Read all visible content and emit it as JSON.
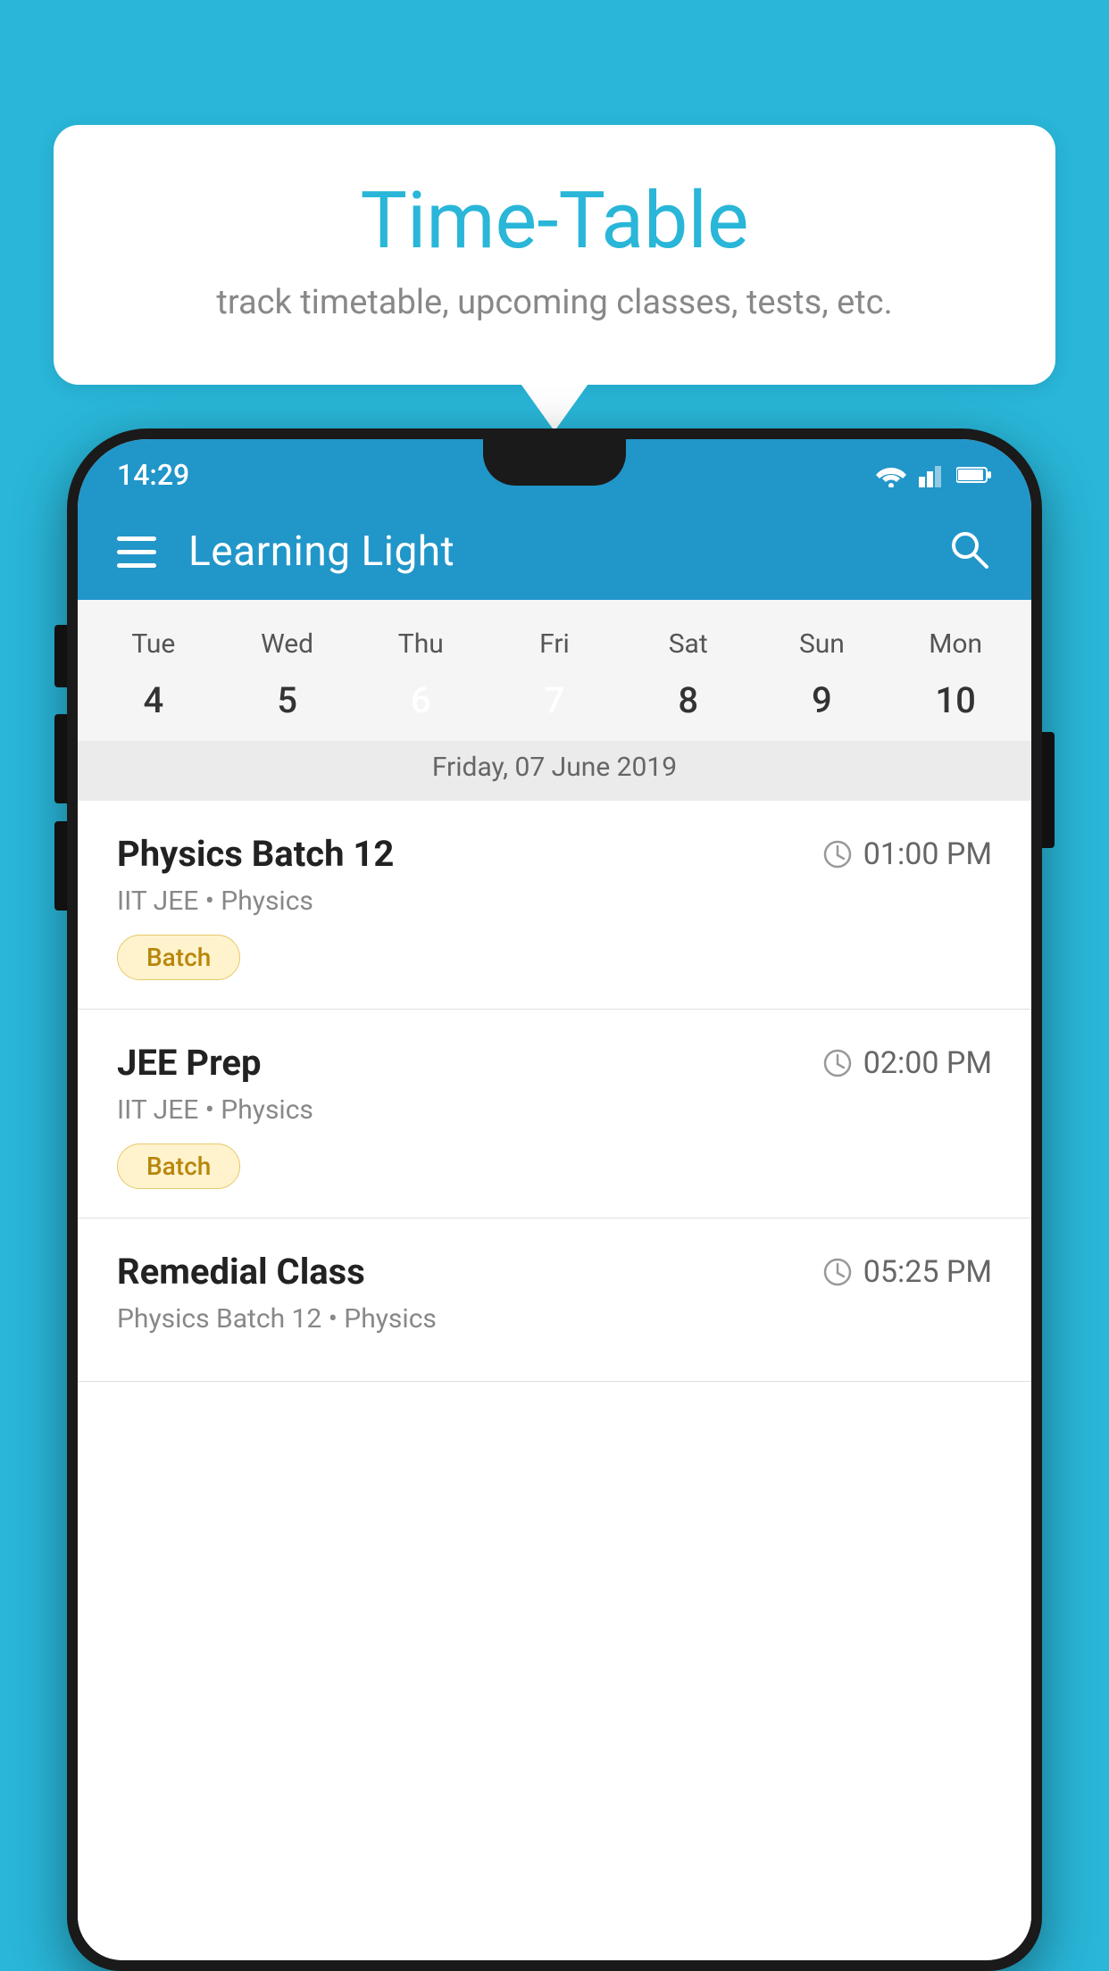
{
  "background_color": "#29B6D8",
  "bubble": {
    "title": "Time-Table",
    "subtitle": "track timetable, upcoming classes, tests, etc."
  },
  "status_bar": {
    "time": "14:29"
  },
  "app_bar": {
    "title": "Learning Light"
  },
  "calendar": {
    "days_of_week": [
      "Tue",
      "Wed",
      "Thu",
      "Fri",
      "Sat",
      "Sun",
      "Mon"
    ],
    "dates": [
      "4",
      "5",
      "6",
      "7",
      "8",
      "9",
      "10"
    ],
    "today_index": 2,
    "selected_index": 3,
    "selected_date_label": "Friday, 07 June 2019"
  },
  "schedule": [
    {
      "title": "Physics Batch 12",
      "time": "01:00 PM",
      "subtitle": "IIT JEE • Physics",
      "badge": "Batch"
    },
    {
      "title": "JEE Prep",
      "time": "02:00 PM",
      "subtitle": "IIT JEE • Physics",
      "badge": "Batch"
    },
    {
      "title": "Remedial Class",
      "time": "05:25 PM",
      "subtitle": "Physics Batch 12 • Physics",
      "badge": null
    }
  ]
}
